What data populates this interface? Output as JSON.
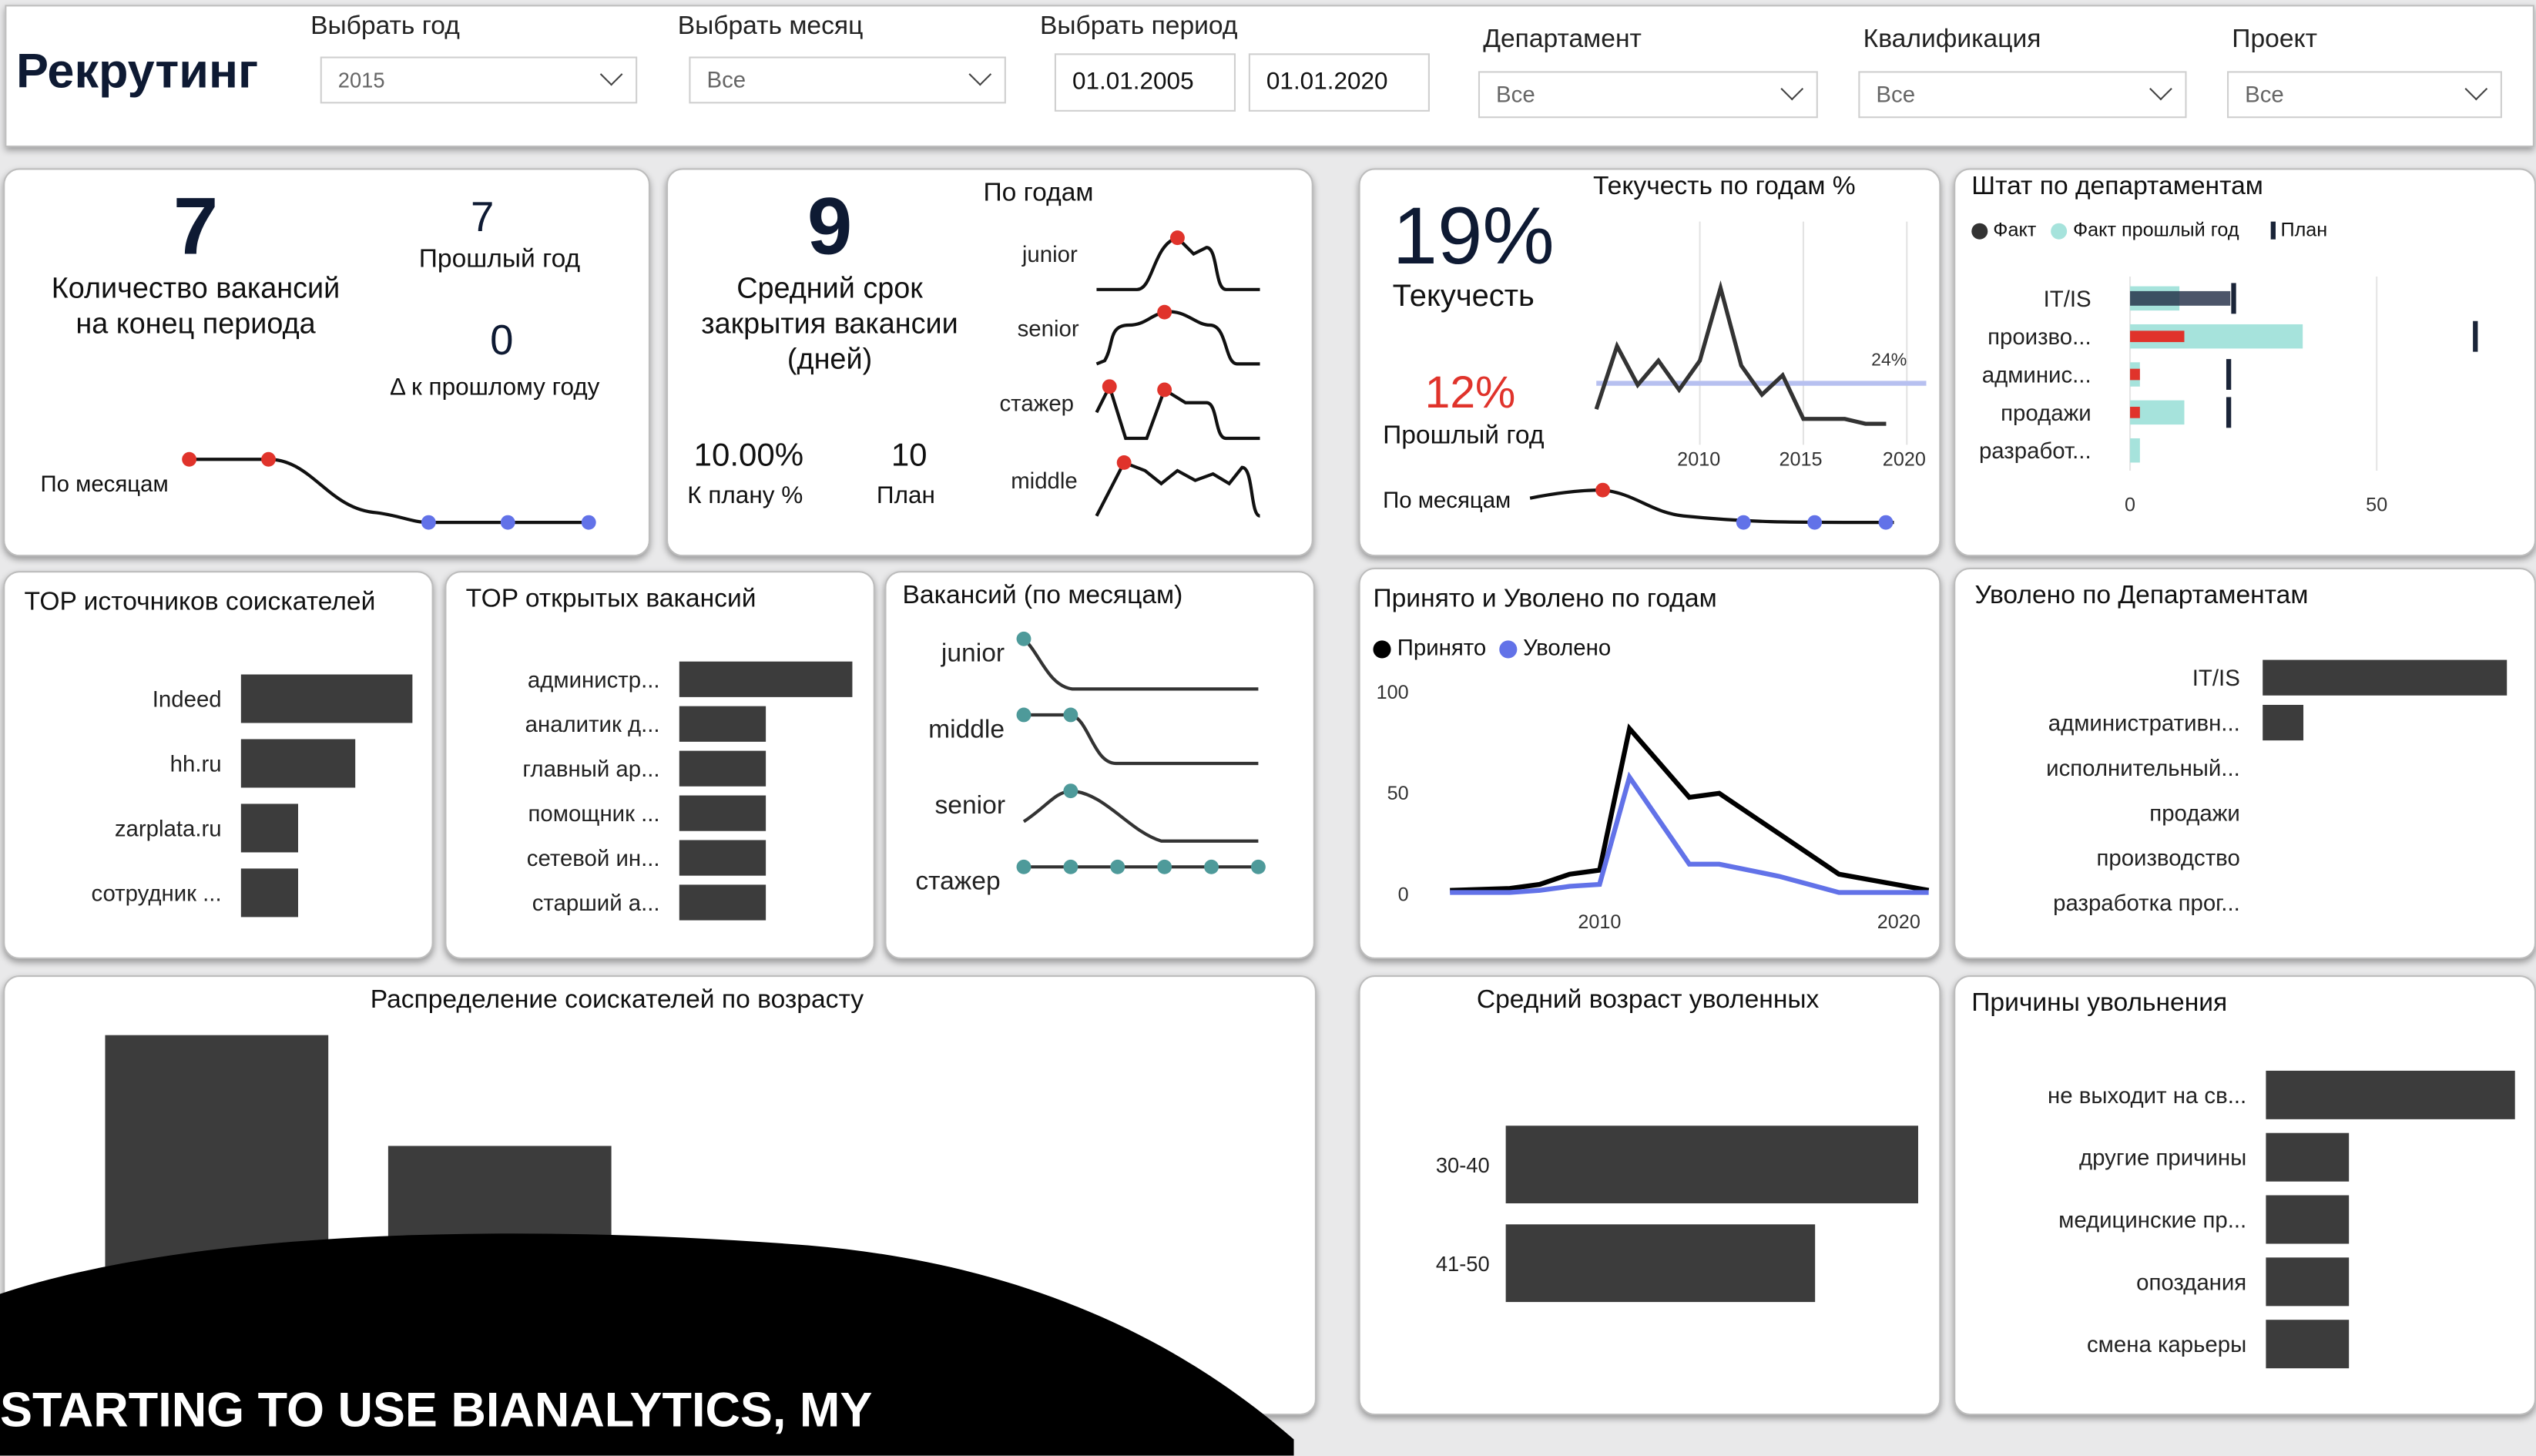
{
  "header": {
    "title": "Рекрутинг",
    "year_label": "Выбрать год",
    "year_value": "2015",
    "month_label": "Выбрать месяц",
    "month_value": "Все",
    "period_label": "Выбрать период",
    "date_from": "01.01.2005",
    "date_to": "01.01.2020",
    "dept_label": "Департамент",
    "dept_value": "Все",
    "qual_label": "Квалификация",
    "qual_value": "Все",
    "project_label": "Проект",
    "project_value": "Все"
  },
  "vacancies": {
    "count": "7",
    "count_label_1": "Количество вакансий",
    "count_label_2": "на конец периода",
    "prev": "7",
    "prev_label": "Прошлый год",
    "delta": "0",
    "delta_label": "Δ к прошлому году",
    "by_month_label": "По месяцам"
  },
  "close_time": {
    "value": "9",
    "label_1": "Средний срок",
    "label_2": "закрытия вакансии",
    "label_3": "(дней)",
    "plan_pct": "10.00%",
    "plan_pct_label": "К плану %",
    "plan": "10",
    "plan_label": "План",
    "by_years_title": "По годам",
    "rows": [
      "junior",
      "senior",
      "стажер",
      "middle"
    ]
  },
  "turnover": {
    "value": "19%",
    "label": "Текучесть",
    "prev": "12%",
    "prev_label": "Прошлый год",
    "chart_title": "Текучесть по годам %",
    "ref_label": "24%",
    "by_month_label": "По месяцам"
  },
  "staff": {
    "title": "Штат по департаментам",
    "legend": [
      "Факт",
      "Факт прошлый год",
      "План"
    ]
  },
  "sources": {
    "title": "TOP источников соискателей"
  },
  "open_vacancies": {
    "title": "TOP открытых вакансий"
  },
  "vac_month": {
    "title": "Вакансий (по месяцам)",
    "rows": [
      "junior",
      "middle",
      "senior",
      "стажер"
    ]
  },
  "hired_fired": {
    "title": "Принято и Уволено по годам",
    "legend": [
      "Принято",
      "Уволено"
    ]
  },
  "fired_dept": {
    "title": "Уволено по Департаментам"
  },
  "age_dist": {
    "title": "Распределение соискателей по возрасту"
  },
  "avg_age": {
    "title": "Средний возраст уволенных"
  },
  "reasons": {
    "title": "Причины увольнения"
  },
  "banner": {
    "text": "STARTING TO USE BIANALYTICS, MY"
  },
  "colors": {
    "bar": "#3c3c3c",
    "red": "#e0332b",
    "blue": "#6272e8",
    "teal": "#a6e3dc",
    "plan": "#1a2438",
    "dot_teal": "#4e9a9a"
  },
  "chart_data": [
    {
      "type": "line",
      "name": "vacancies_by_month",
      "x": [
        1,
        2,
        3,
        4,
        5,
        6
      ],
      "values": [
        7,
        7,
        5,
        4,
        4,
        4
      ]
    },
    {
      "type": "line",
      "name": "turnover_by_year",
      "x": [
        2005,
        2006,
        2007,
        2008,
        2009,
        2010,
        2011,
        2012,
        2013,
        2014,
        2015,
        2016,
        2017,
        2018,
        2019
      ],
      "values": [
        5,
        18,
        10,
        15,
        9,
        15,
        30,
        14,
        8,
        12,
        3,
        3,
        3,
        2,
        2
      ],
      "ylabel": "",
      "ref_value": 24,
      "ref_label": "24%",
      "xticks": [
        "2010",
        "2015",
        "2020"
      ]
    },
    {
      "type": "bar",
      "name": "staff_by_department",
      "categories": [
        "IT/IS",
        "произво...",
        "админис...",
        "продажи",
        "разработ..."
      ],
      "series": [
        {
          "name": "Факт",
          "values": [
            0,
            11,
            2,
            2,
            0
          ]
        },
        {
          "name": "Факт прошлый год",
          "values": [
            10,
            35,
            2,
            11,
            2
          ]
        },
        {
          "name": "План",
          "values": [
            21,
            70,
            20,
            20,
            null
          ]
        }
      ],
      "xticks": [
        "0",
        "50"
      ],
      "xlim": [
        0,
        75
      ]
    },
    {
      "type": "bar",
      "name": "top_sources",
      "categories": [
        "Indeed",
        "hh.ru",
        "zarplata.ru",
        "сотрудник ..."
      ],
      "values": [
        3,
        2,
        1,
        1
      ]
    },
    {
      "type": "bar",
      "name": "top_open_vacancies",
      "categories": [
        "администр...",
        "аналитик д...",
        "главный ар...",
        "помощник ...",
        "сетевой ин...",
        "старший а..."
      ],
      "values": [
        2,
        1,
        1,
        1,
        1,
        1
      ]
    },
    {
      "type": "line",
      "name": "hired_fired_by_year",
      "x": [
        2005,
        2007,
        2008,
        2009,
        2010,
        2011,
        2013,
        2014,
        2016,
        2018,
        2021
      ],
      "series": [
        {
          "name": "Принято",
          "values": [
            2,
            3,
            5,
            10,
            12,
            82,
            48,
            50,
            30,
            10,
            2
          ]
        },
        {
          "name": "Уволено",
          "values": [
            1,
            1,
            2,
            4,
            5,
            58,
            15,
            15,
            9,
            1,
            1
          ]
        }
      ],
      "ylim": [
        0,
        100
      ],
      "yticks": [
        "0",
        "50",
        "100"
      ],
      "xticks": [
        "2010",
        "2020"
      ]
    },
    {
      "type": "bar",
      "name": "fired_by_department",
      "categories": [
        "IT/IS",
        "административн...",
        "исполнительный...",
        "продажи",
        "производство",
        "разработка прог..."
      ],
      "values": [
        6,
        1,
        0,
        0,
        0,
        0
      ]
    },
    {
      "type": "bar",
      "name": "age_distribution",
      "categories": [
        "",
        ""
      ],
      "values": [
        2,
        1.5
      ]
    },
    {
      "type": "bar",
      "name": "avg_age_fired",
      "categories": [
        "30-40",
        "41-50"
      ],
      "values": [
        6,
        4.5
      ]
    },
    {
      "type": "bar",
      "name": "fire_reasons",
      "categories": [
        "не выходит на св...",
        "другие причины",
        "медицинские пр...",
        "опоздания",
        "смена карьеры"
      ],
      "values": [
        3,
        1,
        1,
        1,
        1
      ]
    }
  ]
}
